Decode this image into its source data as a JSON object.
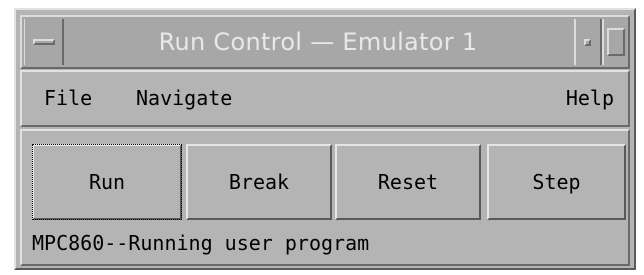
{
  "window": {
    "title": "Run Control — Emulator 1"
  },
  "menubar": {
    "items": [
      "File",
      "Navigate",
      "Help"
    ]
  },
  "buttons": {
    "run_label": "Run",
    "break_label": "Break",
    "reset_label": "Reset",
    "step_label": "Step"
  },
  "status": {
    "text": "MPC860--Running user program"
  },
  "icons": {
    "window_menu": "window-menu-icon",
    "minimize": "minimize-icon",
    "maximize": "maximize-icon"
  },
  "colors": {
    "window_bg": "#b4b4b4",
    "titlebar_bg": "#a7a7a7",
    "title_text": "#e8e8e8"
  }
}
